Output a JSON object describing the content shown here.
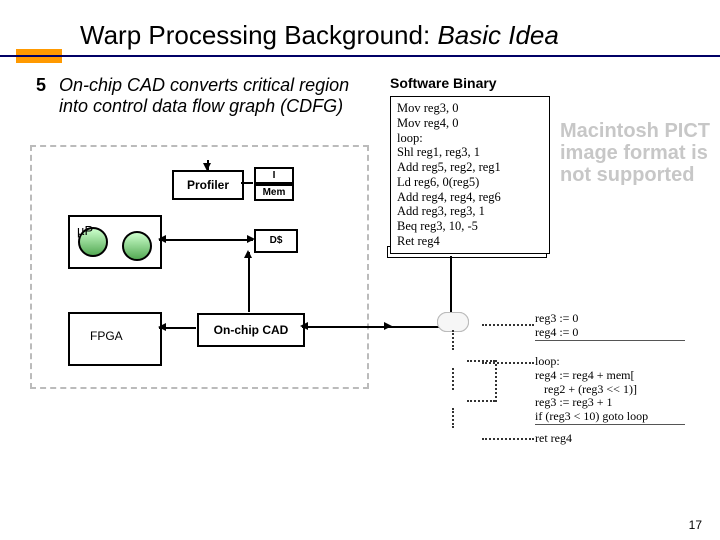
{
  "title": {
    "plain": "Warp Processing Background: ",
    "italic": "Basic Idea"
  },
  "step": {
    "num": "5",
    "desc": "On-chip CAD converts critical region into control data flow graph (CDFG)"
  },
  "software_binary": {
    "heading": "Software Binary",
    "lines": [
      "Mov reg3, 0",
      "Mov reg4, 0",
      "loop:",
      "Shl reg1, reg3, 1",
      "Add reg5, reg2, reg1",
      "Ld reg6, 0(reg5)",
      "Add reg4, reg4, reg6",
      "Add reg3, reg3, 1",
      "Beq reg3, 10, -5",
      "Ret reg4"
    ]
  },
  "error_text": "Macintosh PICT image format is not supported",
  "area": {
    "profiler": "Profiler",
    "i": "I",
    "mem": "Mem",
    "ds": "D$",
    "up": "µP",
    "oncad": "On-chip CAD",
    "fpga": "FPGA"
  },
  "pseudo": {
    "block1": [
      "reg3 := 0",
      "reg4 := 0"
    ],
    "block2": [
      "loop:",
      "reg4 := reg4 + mem[",
      "   reg2 + (reg3 << 1)]",
      "reg3 := reg3 + 1",
      "if (reg3 < 10) goto loop"
    ],
    "block3": [
      "ret reg4"
    ]
  },
  "page_number": "17"
}
